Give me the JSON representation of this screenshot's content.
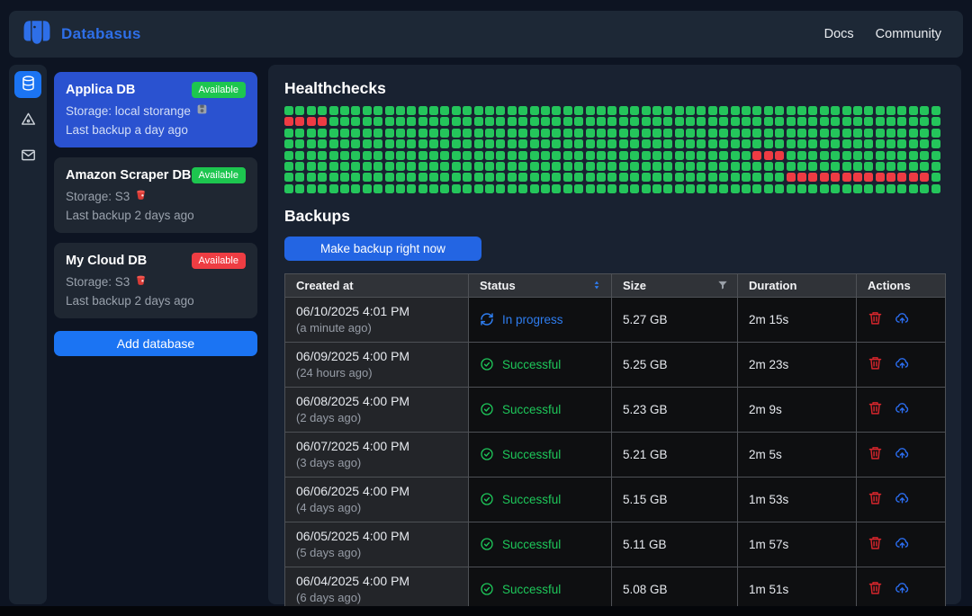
{
  "navbar": {
    "brand": "Databasus",
    "links": [
      {
        "label": "Docs"
      },
      {
        "label": "Community"
      }
    ]
  },
  "sidebar": {
    "items": [
      {
        "icon": "database-icon",
        "active": true
      },
      {
        "icon": "drive-icon",
        "active": false
      },
      {
        "icon": "mail-icon",
        "active": false
      }
    ]
  },
  "database_list": {
    "add_button_label": "Add database",
    "databases": [
      {
        "name": "Applica DB",
        "badge": "Available",
        "badge_color": "#1dc64f",
        "storage": "Storage: local storange",
        "storage_icon": "disk-icon",
        "last_backup": "Last backup a day ago",
        "selected": true
      },
      {
        "name": "Amazon Scraper DB",
        "badge": "Available",
        "badge_color": "#1dc64f",
        "storage": "Storage: S3",
        "storage_icon": "s3-bucket-icon",
        "last_backup": "Last backup 2 days ago",
        "selected": false
      },
      {
        "name": "My Cloud DB",
        "badge": "Available",
        "badge_color": "#ee3d43",
        "storage": "Storage: S3",
        "storage_icon": "s3-bucket-icon",
        "last_backup": "Last backup 2 days ago",
        "selected": false
      }
    ]
  },
  "healthchecks": {
    "title": "Healthchecks",
    "grid": {
      "rows": 8,
      "cols": 59,
      "ok_color": "#24c55b",
      "fail_color": "#ee3b43",
      "fail_runs": [
        {
          "row": 1,
          "from": 0,
          "to": 3
        },
        {
          "row": 4,
          "from": 42,
          "to": 44
        },
        {
          "row": 6,
          "from": 45,
          "to": 57
        }
      ]
    }
  },
  "backups": {
    "title": "Backups",
    "make_backup_label": "Make backup right now",
    "table": {
      "columns": [
        "Created at",
        "Status",
        "Size",
        "Duration",
        "Actions"
      ],
      "status_colors": {
        "progress": "#2e7df0",
        "success": "#1ec75a"
      },
      "rows": [
        {
          "date": "06/10/2025 4:01 PM",
          "ago": "(a minute ago)",
          "status": "In progress",
          "status_type": "progress",
          "size": "5.27 GB",
          "duration": "2m 15s"
        },
        {
          "date": "06/09/2025 4:00 PM",
          "ago": "(24 hours ago)",
          "status": "Successful",
          "status_type": "success",
          "size": "5.25 GB",
          "duration": "2m 23s"
        },
        {
          "date": "06/08/2025 4:00 PM",
          "ago": "(2 days ago)",
          "status": "Successful",
          "status_type": "success",
          "size": "5.23 GB",
          "duration": "2m 9s"
        },
        {
          "date": "06/07/2025 4:00 PM",
          "ago": "(3 days ago)",
          "status": "Successful",
          "status_type": "success",
          "size": "5.21 GB",
          "duration": "2m 5s"
        },
        {
          "date": "06/06/2025 4:00 PM",
          "ago": "(4 days ago)",
          "status": "Successful",
          "status_type": "success",
          "size": "5.15 GB",
          "duration": "1m 53s"
        },
        {
          "date": "06/05/2025 4:00 PM",
          "ago": "(5 days ago)",
          "status": "Successful",
          "status_type": "success",
          "size": "5.11 GB",
          "duration": "1m 57s"
        },
        {
          "date": "06/04/2025 4:00 PM",
          "ago": "(6 days ago)",
          "status": "Successful",
          "status_type": "success",
          "size": "5.08 GB",
          "duration": "1m 51s"
        }
      ]
    }
  }
}
